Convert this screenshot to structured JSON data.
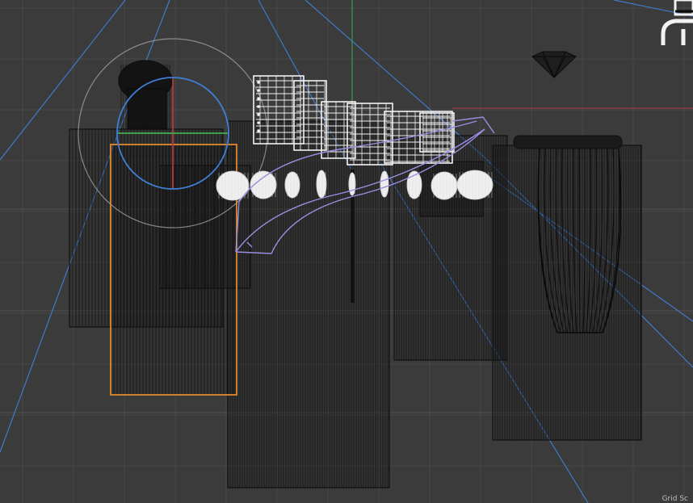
{
  "viewport": {
    "grid_label": "Grid Sc",
    "colors": {
      "background": "#3b3b3b",
      "grid_minor": "#444444",
      "grid_major": "#4d4d4d",
      "axis_green": "#3fae4f",
      "axis_red": "#b33a3a",
      "camera_blue": "#3f7fd6",
      "selection_orange": "#e08a2e",
      "wire": "#0f0f0f",
      "light_white": "#f2f2f2",
      "curve_lavender": "#9a8ee0"
    },
    "icons": [
      "camera-frustum-icon",
      "gem-icon",
      "corner-arc-icon"
    ]
  }
}
